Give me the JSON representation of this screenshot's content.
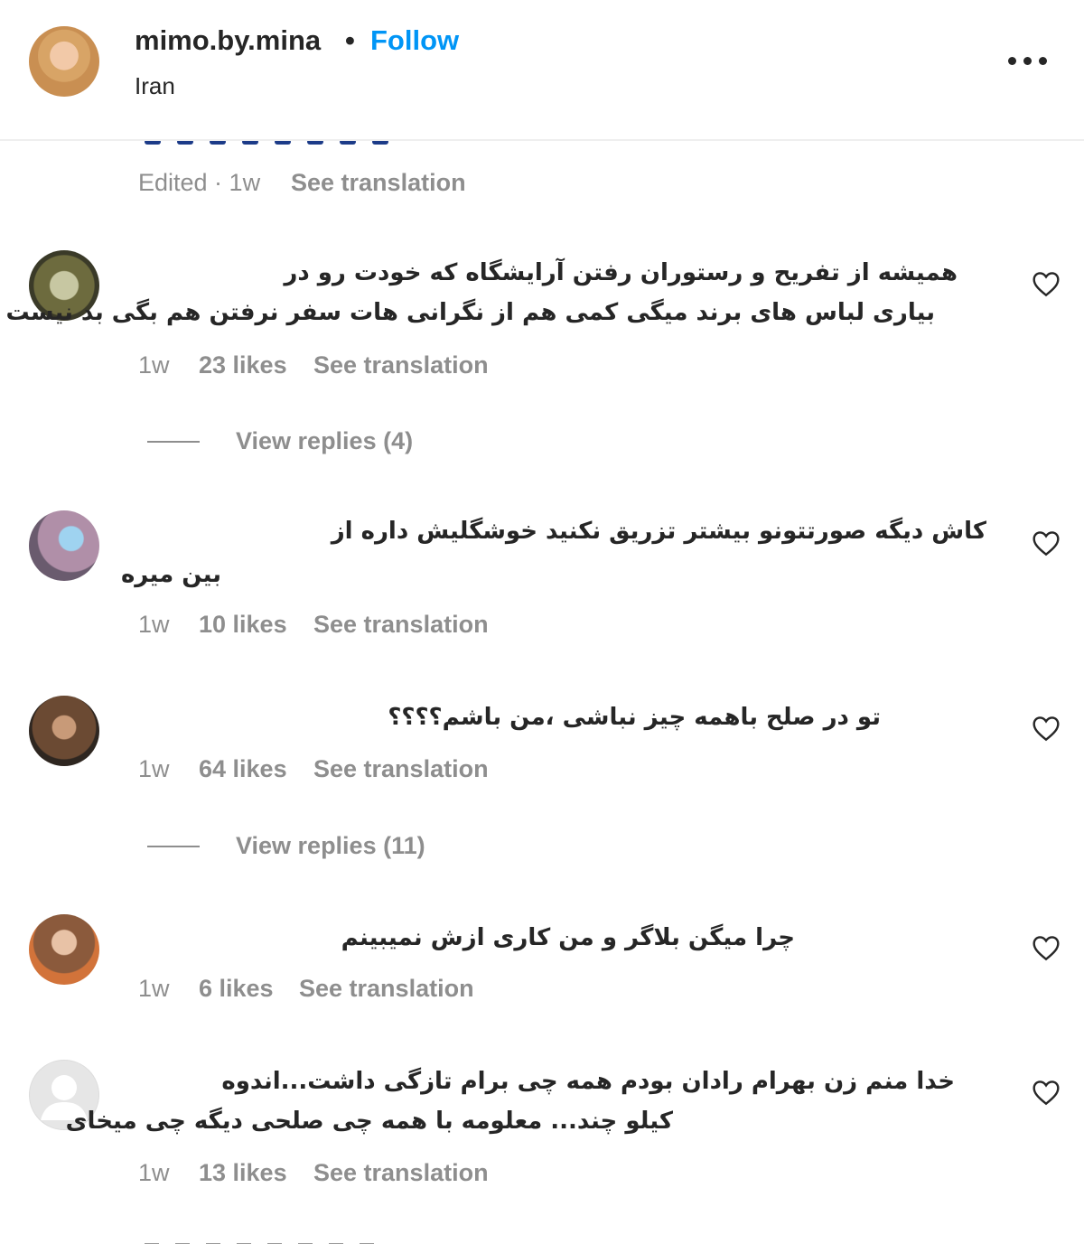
{
  "header": {
    "username": "mimo.by.mina",
    "separator": "•",
    "follow_label": "Follow",
    "location": "Iran",
    "more_icon": "more-horizontal-icon"
  },
  "previous_comment": {
    "edited_time": "Edited · 1w",
    "see_translation": "See translation"
  },
  "comments": [
    {
      "line1": "همیشه از تفریح و رستوران رفتن آرایشگاه که خودت رو در",
      "line2": "بیاری لباس های برند میگی کمی هم از نگرانی هات سفر نرفتن هم بگی بد نیست",
      "time": "1w",
      "likes": "23 likes",
      "see_translation": "See translation",
      "view_replies": "View replies (4)"
    },
    {
      "line1": "کاش دیگه صورتتونو بیشتر تزریق نکنید خوشگلیش داره از",
      "line2": "بین میره",
      "time": "1w",
      "likes": "10 likes",
      "see_translation": "See translation"
    },
    {
      "line1": "تو در صلح باهمه چیز نباشی ،من باشم؟؟؟؟",
      "time": "1w",
      "likes": "64 likes",
      "see_translation": "See translation",
      "view_replies": "View replies (11)"
    },
    {
      "line1": "چرا میگن بلاگر و من کاری ازش نمیبینم",
      "time": "1w",
      "likes": "6 likes",
      "see_translation": "See translation"
    },
    {
      "line1": "خدا منم زن بهرام رادان بودم همه چی برام تازگی داشت...اندوه",
      "line2": "کیلو چند... معلومه با همه چی صلحی دیگه چی میخای",
      "time": "1w",
      "likes": "13 likes",
      "see_translation": "See translation"
    }
  ],
  "colors": {
    "follow": "#0095f6",
    "text": "#262626",
    "meta": "#8e8e8e"
  }
}
